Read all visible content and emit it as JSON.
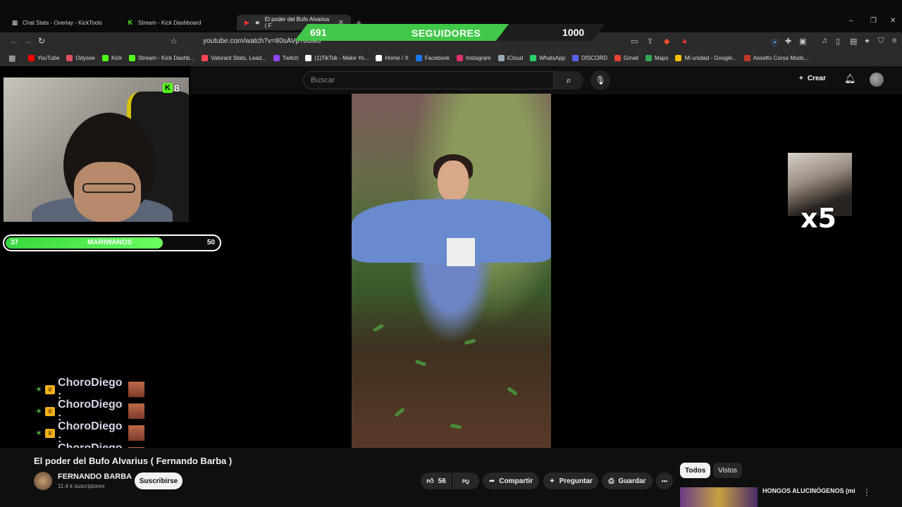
{
  "tabs": [
    {
      "title": "Chat Stats - Overlay - KickTools",
      "icon": "grid-icon"
    },
    {
      "title": "Stream - Kick Dashboard",
      "icon": "kick-icon"
    },
    {
      "title": "El poder del Bufo Alvarius ( F",
      "icon": "youtube-icon",
      "active": true
    }
  ],
  "window": {
    "minimize": "–",
    "restore": "❐",
    "close": "✕",
    "new_tab": "+"
  },
  "address": {
    "url": "youtube.com/watch?v=80sAVp?80M0"
  },
  "bookmarks": [
    {
      "label": "YouTube",
      "color": "#ff0000"
    },
    {
      "label": "Odysee",
      "color": "#e04f5f"
    },
    {
      "label": "Kick",
      "color": "#53fc18"
    },
    {
      "label": "Stream - Kick Dashb...",
      "color": "#53fc18"
    },
    {
      "label": "Valorant Stats, Lead...",
      "color": "#ff4655"
    },
    {
      "label": "Twitch",
      "color": "#9146ff"
    },
    {
      "label": "(1)TikTok - Make Yo...",
      "color": "#ffffff"
    },
    {
      "label": "Home / X",
      "color": "#ffffff"
    },
    {
      "label": "Facebook",
      "color": "#1877f2"
    },
    {
      "label": "Instagram",
      "color": "#e1306c"
    },
    {
      "label": "iCloud",
      "color": "#9ab"
    },
    {
      "label": "WhatsApp",
      "color": "#25d366"
    },
    {
      "label": "DISCORD",
      "color": "#5865f2"
    },
    {
      "label": "Gmail",
      "color": "#ea4335"
    },
    {
      "label": "Maps",
      "color": "#34a853"
    },
    {
      "label": "Mi unidad - Google...",
      "color": "#fbbc04"
    },
    {
      "label": "Assetto Corsa Mods...",
      "color": "#c0392b"
    }
  ],
  "followers": {
    "current": "691",
    "label": "SEGUIDORES",
    "goal": "1000",
    "progress": 0.691,
    "color": "#41c84a"
  },
  "kick_viewers": {
    "icon": "K",
    "count": "8"
  },
  "mariwanos": {
    "current": "37",
    "label": "MARIWANOS",
    "goal": "50",
    "progress": 0.74
  },
  "multiplier": "x5",
  "chat": {
    "messages": [
      {
        "user": "ChoroDiego :"
      },
      {
        "user": "ChoroDiego :"
      },
      {
        "user": "ChoroDiego :"
      },
      {
        "user": "ChoroDiego :"
      }
    ]
  },
  "youtube": {
    "search_placeholder": "Buscar",
    "create_label": "Crear",
    "video_title": "El poder del Bufo Alvarius ( Fernando Barba )",
    "channel": {
      "name": "FERNANDO BARBA",
      "subs": "11.4 k suscriptores"
    },
    "subscribe_label": "Suscribirse",
    "likes": "56",
    "share_label": "Compartir",
    "ask_label": "Preguntar",
    "save_label": "Guardar",
    "more_label": "•••",
    "filter_chips": [
      "Todos",
      "Vistos"
    ],
    "related_title": "HONGOS ALUCINÓGENOS (mi"
  }
}
